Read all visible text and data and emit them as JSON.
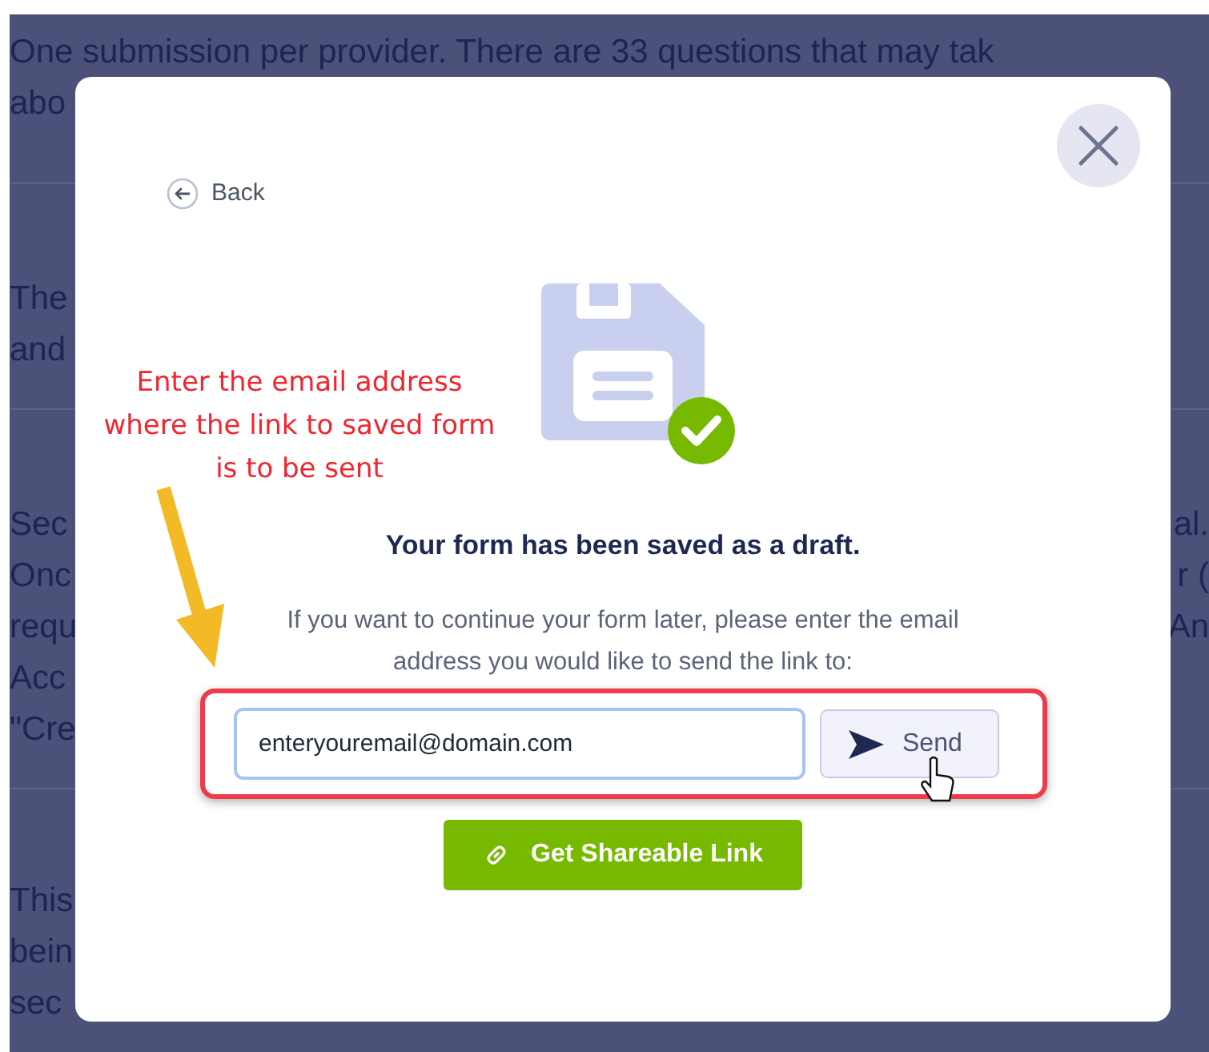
{
  "background": {
    "sections": [
      {
        "lines": [
          {
            "left": "One submission per provider. There are 33 questions that may tak"
          },
          {
            "left": "abo"
          }
        ]
      },
      {
        "lines": [
          {
            "left": "The"
          },
          {
            "left": "and"
          }
        ]
      },
      {
        "lines": [
          {
            "left": "Sec",
            "right": "al."
          },
          {
            "left": "Onc",
            "right": "r ("
          },
          {
            "left": "requ",
            "right": "An"
          },
          {
            "left": "Acc"
          },
          {
            "left": "\"Cre"
          }
        ]
      },
      {
        "lines": [
          {
            "left": "This"
          },
          {
            "left": "bein"
          },
          {
            "left": "sec"
          }
        ]
      }
    ]
  },
  "dialog": {
    "back": "Back",
    "heading": "Your form has been saved as a draft.",
    "message": "If you want to continue your form later, please enter the email address you would like to send the link to:",
    "email": {
      "value": "enteryouremail@domain.com",
      "focused": true
    },
    "send": "Send",
    "share": "Get Shareable Link"
  },
  "annotation": {
    "text": "Enter the email address where the link to saved form is to be sent"
  }
}
